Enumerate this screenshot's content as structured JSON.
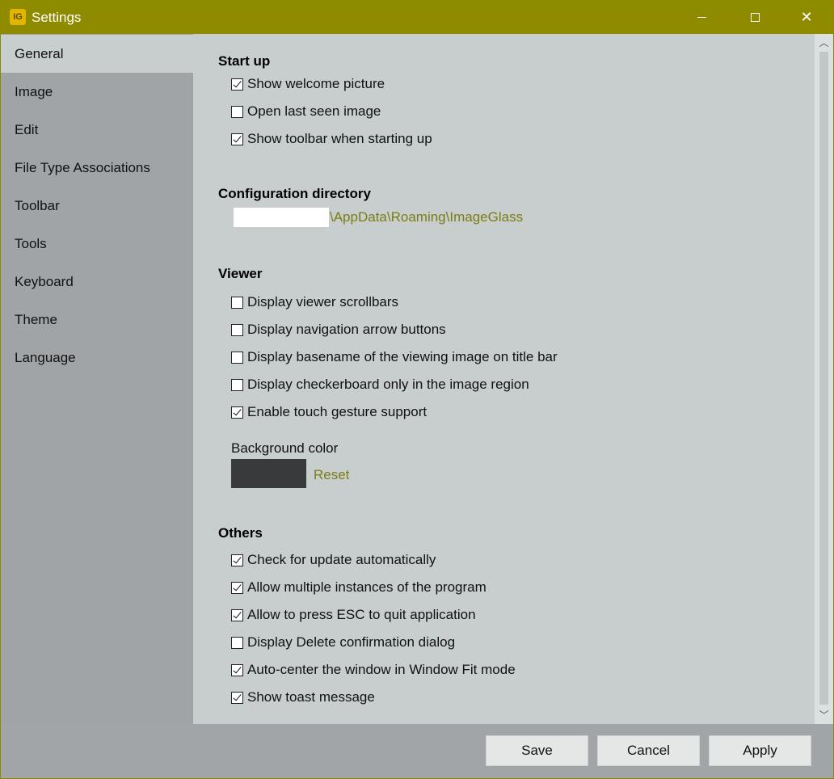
{
  "window": {
    "title": "Settings",
    "app_icon": "imageglass-icon",
    "accent_color": "#8f8b00"
  },
  "sidebar": {
    "items": [
      {
        "label": "General",
        "active": true
      },
      {
        "label": "Image"
      },
      {
        "label": "Edit"
      },
      {
        "label": "File Type Associations"
      },
      {
        "label": "Toolbar"
      },
      {
        "label": "Tools"
      },
      {
        "label": "Keyboard"
      },
      {
        "label": "Theme"
      },
      {
        "label": "Language"
      }
    ]
  },
  "startup": {
    "title": "Start up",
    "options": [
      {
        "label": "Show welcome picture",
        "checked": true
      },
      {
        "label": "Open last seen image",
        "checked": false
      },
      {
        "label": "Show toolbar when starting up",
        "checked": true
      }
    ]
  },
  "config": {
    "title": "Configuration directory",
    "path": "\\AppData\\Roaming\\ImageGlass"
  },
  "viewer": {
    "title": "Viewer",
    "options": [
      {
        "label": "Display viewer scrollbars",
        "checked": false
      },
      {
        "label": "Display navigation arrow buttons",
        "checked": false
      },
      {
        "label": "Display basename of the viewing image on title bar",
        "checked": false
      },
      {
        "label": "Display checkerboard only in the image region",
        "checked": false
      },
      {
        "label": "Enable touch gesture support",
        "checked": true
      }
    ],
    "background_color_label": "Background color",
    "background_color": "#383a3c",
    "reset_label": "Reset"
  },
  "others": {
    "title": "Others",
    "options": [
      {
        "label": "Check for update automatically",
        "checked": true
      },
      {
        "label": "Allow multiple instances of the program",
        "checked": true
      },
      {
        "label": "Allow to press ESC to quit application",
        "checked": true
      },
      {
        "label": "Display Delete confirmation dialog",
        "checked": false
      },
      {
        "label": "Auto-center the window in Window Fit mode",
        "checked": true
      },
      {
        "label": "Show toast message",
        "checked": true
      }
    ]
  },
  "buttons": {
    "save": "Save",
    "cancel": "Cancel",
    "apply": "Apply"
  }
}
